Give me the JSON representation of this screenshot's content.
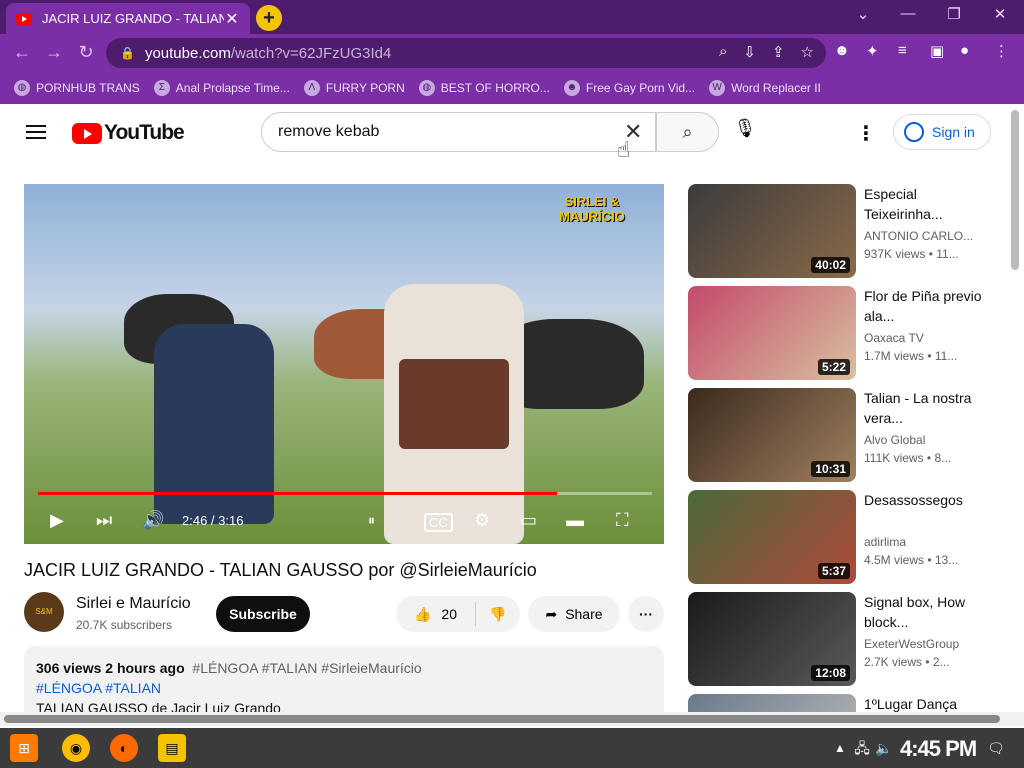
{
  "browser": {
    "tab_title": "JACIR LUIZ GRANDO - TALIAN",
    "tab_close": "✕",
    "new_tab": "+",
    "url_host": "youtube.com",
    "url_path": "/watch?v=62JFzUG3Id4",
    "bookmarks": [
      {
        "label": "PORNHUB TRANS",
        "icon": "globe-icon"
      },
      {
        "label": "Anal Prolapse Time...",
        "icon": "bookmark-icon"
      },
      {
        "label": "FURRY PORN",
        "icon": "lambda-icon"
      },
      {
        "label": "BEST OF HORRO...",
        "icon": "globe-icon"
      },
      {
        "label": "Free Gay Porn Vid...",
        "icon": "site-icon"
      },
      {
        "label": "Word Replacer II",
        "icon": "wr-icon"
      }
    ]
  },
  "header": {
    "logo_text": "YouTube",
    "search_value": "remove kebab",
    "signin_label": "Sign in"
  },
  "video": {
    "title": "JACIR LUIZ GRANDO - TALIAN GAUSSO por @SirleieMaurício",
    "time": "2:46 / 3:16",
    "progress": 0.846,
    "watermark_line1": "SIRLEI &",
    "watermark_line2": "MAURÍCIO",
    "channel": "Sirlei e Maurício",
    "subscribers": "20.7K subscribers",
    "subscribe_label": "Subscribe",
    "likes": "20",
    "share_label": "Share",
    "views_line": "306 views  2 hours ago",
    "tags_line": "#LÉNGOA #TALIAN #SirleieMaurício",
    "desc_hashtags": "#LÉNGOA #TALIAN",
    "desc_text": "TALIAN GAUSSO de Jacir Luiz Grando"
  },
  "sidebar": [
    {
      "title": "Especial Teixeirinha...",
      "channel": "ANTONIO CARLO...",
      "meta": "937K views  • 11...",
      "duration": "40:02",
      "colors": [
        "#3b3b3b",
        "#8a6a4a"
      ]
    },
    {
      "title": "Flor de Piña previo ala...",
      "channel": "Oaxaca TV",
      "meta": "1.7M views  • 11...",
      "duration": "5:22",
      "colors": [
        "#c44a6a",
        "#d8c0a0"
      ]
    },
    {
      "title": "Talian - La nostra vera...",
      "channel": "Alvo Global",
      "meta": "111K views  • 8...",
      "duration": "10:31",
      "colors": [
        "#3a2a1e",
        "#a08060"
      ]
    },
    {
      "title": "Desassossegos",
      "channel": "adirlima",
      "meta": "4.5M views  • 13...",
      "duration": "5:37",
      "colors": [
        "#4a6a3a",
        "#b04a3a"
      ]
    },
    {
      "title": "Signal box, How block...",
      "channel": "ExeterWestGroup",
      "meta": "2.7K views  • 2...",
      "duration": "12:08",
      "colors": [
        "#1a1a1a",
        "#5a5a5a"
      ]
    },
    {
      "title": "1ºLugar Dança",
      "channel": "",
      "meta": "",
      "duration": "",
      "colors": [
        "#6a7a8a",
        "#c0c0c0"
      ]
    }
  ],
  "taskbar": {
    "clock": "4:45 PM"
  }
}
